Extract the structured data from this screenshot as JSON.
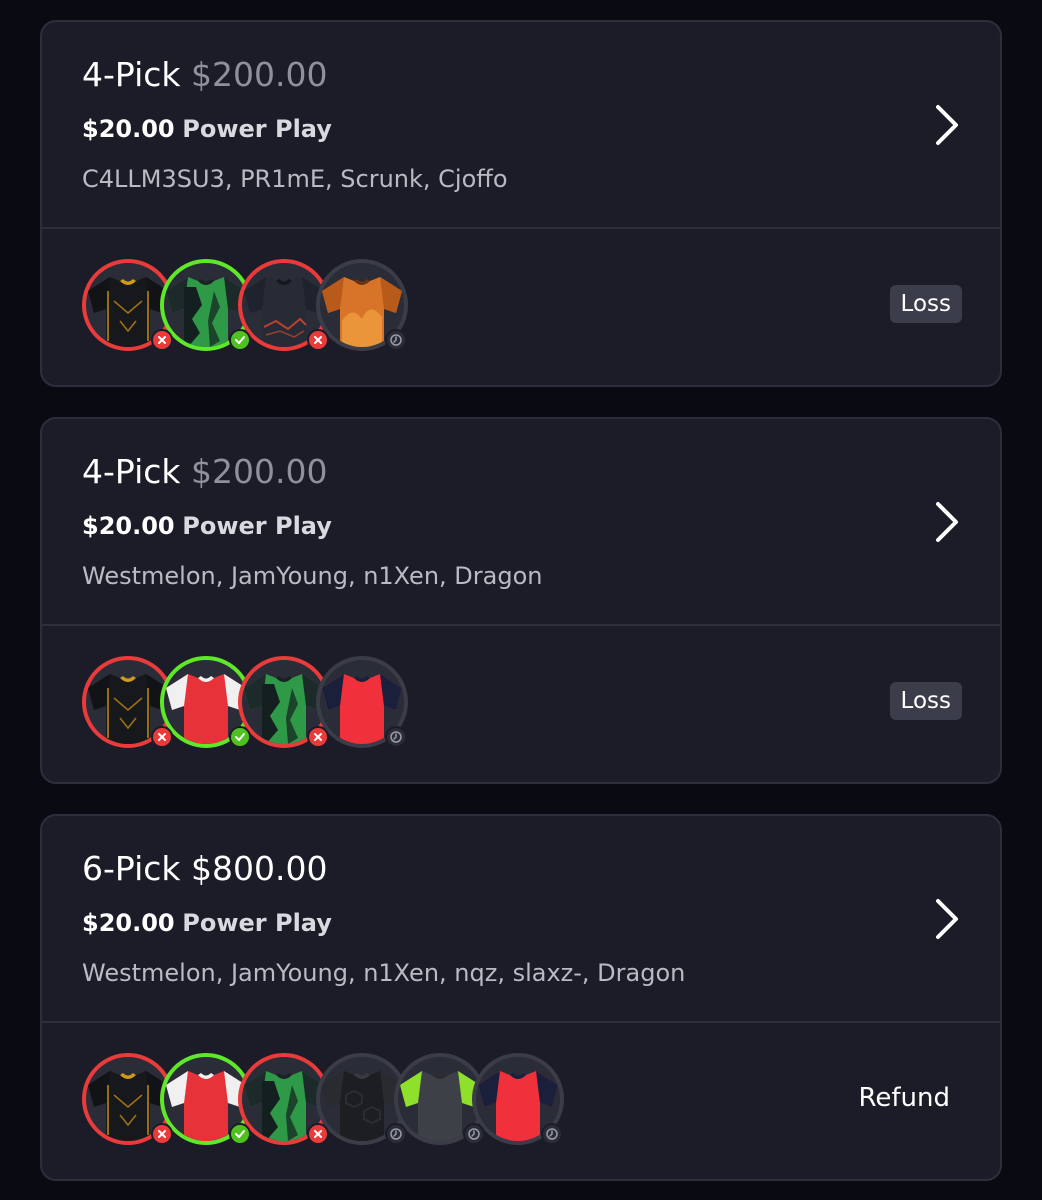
{
  "colors": {
    "background": "#090a12",
    "card": "#1b1c27",
    "loss": "#ea3b3b",
    "win": "#5fe82a",
    "pending": "#3a3c48",
    "muted_payout": "#8e909c"
  },
  "cards": [
    {
      "pick_label": "4-Pick",
      "payout": "$200.00",
      "entry_amount": "$20.00",
      "entry_type": "Power Play",
      "players": "C4LLM3SU3, PR1mE, Scrunk, Cjoffo",
      "status": "Loss",
      "picks": [
        {
          "result": "loss",
          "jersey": "black-gold"
        },
        {
          "result": "win",
          "jersey": "green-black"
        },
        {
          "result": "loss",
          "jersey": "dark-red"
        },
        {
          "result": "pending",
          "jersey": "orange"
        }
      ]
    },
    {
      "pick_label": "4-Pick",
      "payout": "$200.00",
      "entry_amount": "$20.00",
      "entry_type": "Power Play",
      "players": "Westmelon, JamYoung, n1Xen, Dragon",
      "status": "Loss",
      "picks": [
        {
          "result": "loss",
          "jersey": "black-gold"
        },
        {
          "result": "win",
          "jersey": "red-white"
        },
        {
          "result": "loss",
          "jersey": "green-black"
        },
        {
          "result": "pending",
          "jersey": "red-navy"
        }
      ]
    },
    {
      "pick_label": "6-Pick",
      "payout": "$800.00",
      "entry_amount": "$20.00",
      "entry_type": "Power Play",
      "players": "Westmelon, JamYoung, n1Xen, nqz, slaxz-, Dragon",
      "status": "Refund",
      "picks": [
        {
          "result": "loss",
          "jersey": "black-gold"
        },
        {
          "result": "win",
          "jersey": "red-white"
        },
        {
          "result": "loss",
          "jersey": "green-black"
        },
        {
          "result": "pending",
          "jersey": "black-grey"
        },
        {
          "result": "pending",
          "jersey": "grey-lime"
        },
        {
          "result": "pending",
          "jersey": "red-navy"
        }
      ]
    }
  ]
}
